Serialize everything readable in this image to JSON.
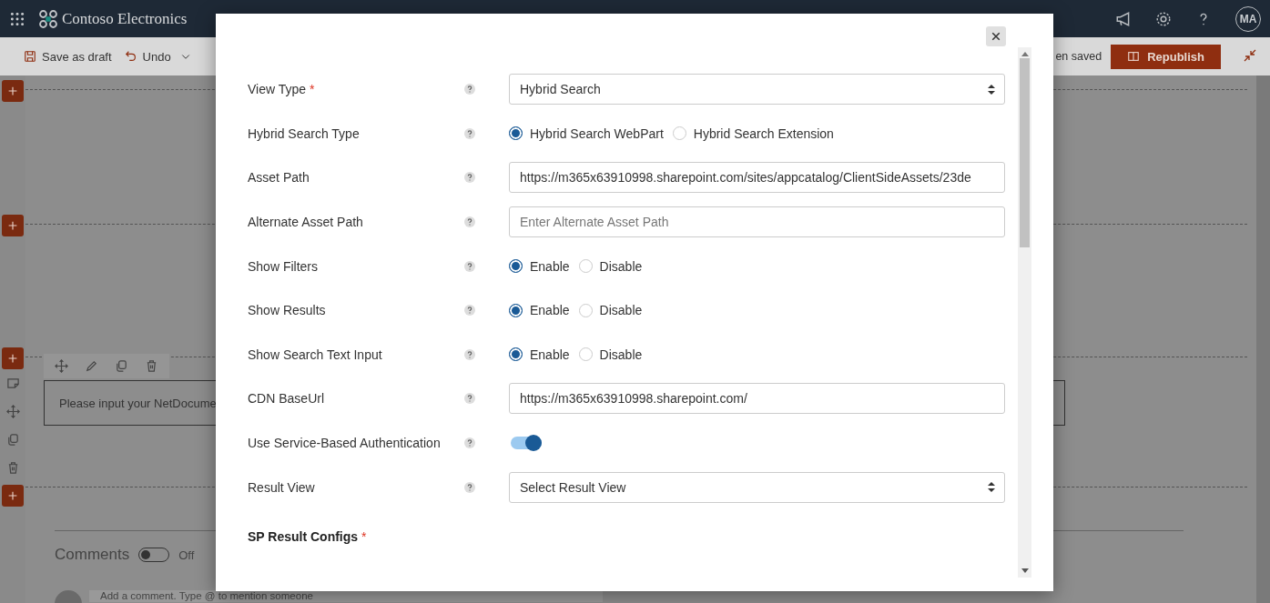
{
  "header": {
    "app_name": "Contoso Electronics",
    "avatar": "MA"
  },
  "toolbar": {
    "save_draft": "Save as draft",
    "undo": "Undo",
    "status": "en saved",
    "publish": "Republish"
  },
  "canvas": {
    "text_box": "Please input your NetDocume",
    "comments": {
      "label": "Comments",
      "on": false,
      "state_text": "Off"
    },
    "comment_placeholder": "Add a comment. Type @ to mention someone"
  },
  "dialog": {
    "fields": [
      {
        "kind": "select",
        "label": "View Type",
        "required_mark": "*",
        "value": "Hybrid Search"
      },
      {
        "kind": "radio",
        "label": "Hybrid Search Type",
        "options": [
          {
            "label": "Hybrid Search WebPart",
            "selected": true
          },
          {
            "label": "Hybrid Search Extension",
            "selected": false
          }
        ]
      },
      {
        "kind": "text",
        "label": "Asset Path",
        "value": "https://m365x63910998.sharepoint.com/sites/appcatalog/ClientSideAssets/23de"
      },
      {
        "kind": "text",
        "label": "Alternate Asset Path",
        "placeholder": "Enter Alternate Asset Path"
      },
      {
        "kind": "radio",
        "label": "Show Filters",
        "options": [
          {
            "label": "Enable",
            "selected": true
          },
          {
            "label": "Disable",
            "selected": false
          }
        ]
      },
      {
        "kind": "radio",
        "label": "Show Results",
        "options": [
          {
            "label": "Enable",
            "selected": true
          },
          {
            "label": "Disable",
            "selected": false
          }
        ]
      },
      {
        "kind": "radio",
        "label": "Show Search Text Input",
        "options": [
          {
            "label": "Enable",
            "selected": true
          },
          {
            "label": "Disable",
            "selected": false
          }
        ]
      },
      {
        "kind": "text",
        "label": "CDN BaseUrl",
        "value": "https://m365x63910998.sharepoint.com/"
      },
      {
        "kind": "toggle",
        "label": "Use Service-Based Authentication",
        "on": true
      },
      {
        "kind": "select",
        "label": "Result View",
        "value": "Select Result View"
      }
    ],
    "section": {
      "title": "SP Result Configs",
      "required_mark": "*"
    }
  }
}
